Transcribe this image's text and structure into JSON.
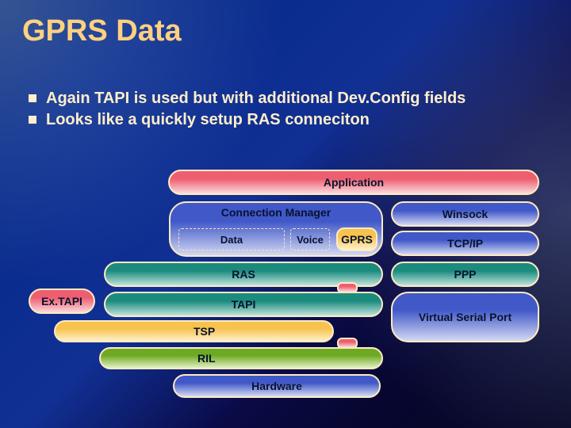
{
  "title": "GPRS Data",
  "bullets": [
    "Again TAPI is used but with additional Dev.Config fields",
    "Looks like a quickly setup RAS conneciton"
  ],
  "boxes": {
    "application": "Application",
    "connmgr": "Connection Manager",
    "gprs": "GPRS",
    "winsock": "Winsock",
    "tcpip": "TCP/IP",
    "ras": "RAS",
    "ppp": "PPP",
    "extapi": "Ex.TAPI",
    "tapi": "TAPI",
    "tsp": "TSP",
    "vsp": "Virtual Serial Port",
    "ril": "RIL",
    "hardware": "Hardware"
  },
  "dashed": {
    "data": "Data",
    "voice": "Voice"
  }
}
